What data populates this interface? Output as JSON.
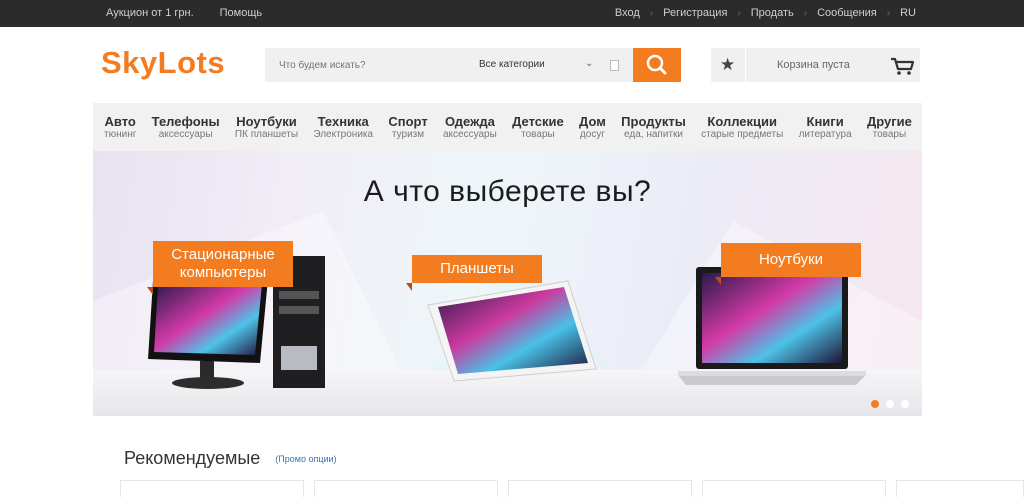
{
  "topbar": {
    "left": [
      "Аукцион от 1 грн.",
      "Помощь"
    ],
    "right": [
      "Вход",
      "Регистрация",
      "Продать",
      "Сообщения",
      "RU"
    ]
  },
  "logo": "SkyLots",
  "search": {
    "placeholder": "Что будем искать?",
    "category": "Все категории"
  },
  "cart": {
    "label": "Корзина пуста"
  },
  "nav": [
    {
      "main": "Авто",
      "sub": "тюнинг"
    },
    {
      "main": "Телефоны",
      "sub": "аксессуары"
    },
    {
      "main": "Ноутбуки",
      "sub": "ПК планшеты"
    },
    {
      "main": "Техника",
      "sub": "Электроника"
    },
    {
      "main": "Спорт",
      "sub": "туризм"
    },
    {
      "main": "Одежда",
      "sub": "аксессуары"
    },
    {
      "main": "Детские",
      "sub": "товары"
    },
    {
      "main": "Дом",
      "sub": "досуг"
    },
    {
      "main": "Продукты",
      "sub": "еда, напитки"
    },
    {
      "main": "Коллекции",
      "sub": "старые предметы"
    },
    {
      "main": "Книги",
      "sub": "литература"
    },
    {
      "main": "Другие",
      "sub": "товары"
    }
  ],
  "banner": {
    "title": "А что выберете вы?",
    "tags": [
      "Стационарные компьютеры",
      "Планшеты",
      "Ноутбуки"
    ],
    "slides": 3,
    "active_slide": 1
  },
  "recommended": {
    "title": "Рекомендуемые",
    "link": "(Промо опции)"
  },
  "colors": {
    "accent": "#f47c20",
    "topbar": "#2b2b2b"
  }
}
